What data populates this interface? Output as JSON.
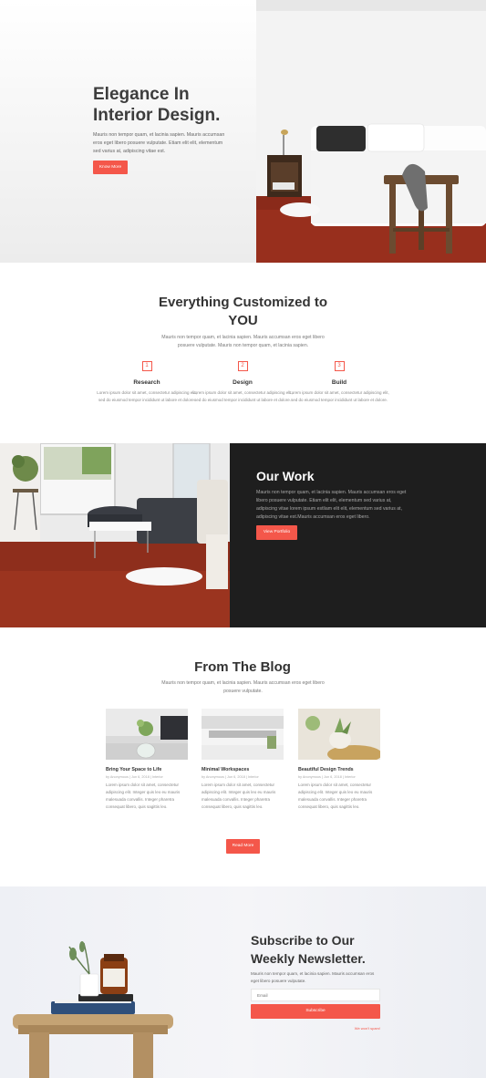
{
  "hero": {
    "title": "Elegance In Interior Design.",
    "text": "Mauris non tempor quam, et lacinia sapien. Mauris accumsan eros eget libero posuere vulputate. Etiam elit elit, elementum sed varius at, adipiscing vitae est.",
    "button": "Know More"
  },
  "features": {
    "title": "Everything Customized to YOU",
    "subtitle": "Mauris non tempor quam, et lacinia sapien. Mauris accumsan eros eget libero posuere vulputate. Mauris non tempor quam, et lacinia sapien.",
    "items": [
      {
        "num": "1",
        "title": "Research",
        "text": "Lorem ipsum dolor sit amet, consectetur adipiscing elit, sed do eiusmod tempor incididunt ut labore et dolore."
      },
      {
        "num": "2",
        "title": "Design",
        "text": "Lorem ipsum dolor sit amet, consectetur adipiscing elit, sed do eiusmod tempor incididunt ut labore et dolore."
      },
      {
        "num": "3",
        "title": "Build",
        "text": "Lorem ipsum dolor sit amet, consectetur adipiscing elit, sed do eiusmod tempor incididunt ut labore et dolore."
      }
    ]
  },
  "work": {
    "title": "Our Work",
    "text": "Mauris non tempor quam, et lacinia sapien. Mauris accumsan eros eget libero posuere vulputate. Etiam elit elit, elementum sed varius at, adipiscing vitae lorem ipsum estliam elit elit, elementum sed varius at, adipiscing vitae est.Mauris accumsan eros eget libero.",
    "button": "View Portfolio"
  },
  "blog": {
    "title": "From The Blog",
    "subtitle": "Mauris non tempor quam, et lacinia sapien. Mauris accumsan eros eget libero posuere vulputate.",
    "posts": [
      {
        "title": "Bring Your Space to Life",
        "meta": "by Anonymous | Jun 6, 2018 | Interior",
        "text": "Lorem ipsum dolor sit amet, consectetur adipiscing elit. Integer quis leo eu mauris malesuada convallis. Integer pharetra consequat libero, quis sagittis leo."
      },
      {
        "title": "Minimal Workspaces",
        "meta": "by Anonymous | Jun 6, 2018 | Interior",
        "text": "Lorem ipsum dolor sit amet, consectetur adipiscing elit. Integer quis leo eu mauris malesuada convallis. Integer pharetra consequat libero, quis sagittis leo."
      },
      {
        "title": "Beautiful Design Trends",
        "meta": "by Anonymous | Jun 6, 2018 | Interior",
        "text": "Lorem ipsum dolor sit amet, consectetur adipiscing elit. Integer quis leo eu mauris malesuada convallis. Integer pharetra consequat libero, quis sagittis leo."
      }
    ],
    "button": "Read More"
  },
  "newsletter": {
    "title": "Subscribe to Our Weekly Newsletter.",
    "text": "Mauris non tempor quam, et lacinia sapien. Mauris accumsan eros eget libero posuere vulputate.",
    "placeholder": "Email",
    "button": "Subscribe",
    "note": "We won't spam!"
  },
  "colors": {
    "accent": "#f4574a",
    "dark": "#1e1e1e"
  }
}
